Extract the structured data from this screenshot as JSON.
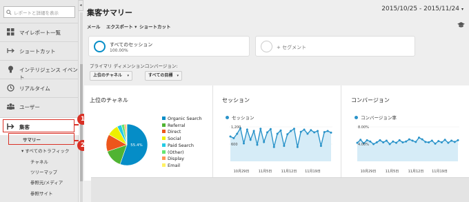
{
  "sidebar": {
    "search_placeholder": "レポートと詳細を表示",
    "collapse": "◂",
    "items": [
      {
        "label": "マイレポート一覧"
      },
      {
        "label": "ショートカット"
      },
      {
        "label": "インテリジェンス イベント"
      },
      {
        "label": "リアルタイム"
      },
      {
        "label": "ユーザー"
      },
      {
        "label": "集客"
      }
    ],
    "sub_items": {
      "summary": "サマリー",
      "all_traffic": "▾ すべてのトラフィック",
      "channels": "チャネル",
      "treemap": "ツリーマップ",
      "source_medium": "参照元/メディア",
      "referrals": "参照サイト"
    }
  },
  "annotations": {
    "badge1": "1",
    "badge2": "2"
  },
  "header": {
    "title": "集客サマリー",
    "date_range": "2015/10/25 - 2015/11/24",
    "date_caret": "▾"
  },
  "toolbar": {
    "email": "メール",
    "export": "エクスポート ▾",
    "shortcut": "ショートカット"
  },
  "segments": {
    "all_sessions": "すべてのセッション",
    "all_sessions_pct": "100.00%",
    "add_segment": "+ セグメント"
  },
  "dimensions": {
    "primary_label": "プライマリ ディメンション:",
    "conversion_label": "コンバージョン:",
    "primary_value": "上位のチャネル",
    "conversion_value": "すべての目標",
    "caret": "▾"
  },
  "panels": {
    "channels_title": "上位のチャネル",
    "sessions_title": "セッション",
    "conversions_title": "コンバージョン",
    "sessions_metric": "セッション",
    "conversions_metric": "コンバージョン率"
  },
  "pie": {
    "center_label": "55.4%",
    "slices": [
      {
        "name": "Organic Search",
        "value": 55.4,
        "color": "#058dc7"
      },
      {
        "name": "Referral",
        "value": 14.4,
        "color": "#50b432"
      },
      {
        "name": "Direct",
        "value": 13.4,
        "color": "#ed561b"
      },
      {
        "name": "Social",
        "value": 9.0,
        "color": "#edef00"
      },
      {
        "name": "Paid Search",
        "value": 3.5,
        "color": "#24cbe5"
      },
      {
        "name": "(Other)",
        "value": 2.3,
        "color": "#64e572"
      },
      {
        "name": "Display",
        "value": 1.2,
        "color": "#ff9655"
      },
      {
        "name": "Email",
        "value": 0.8,
        "color": "#fff263"
      }
    ]
  },
  "chart_data": [
    {
      "type": "area",
      "series": [
        {
          "name": "セッション",
          "values": [
            900,
            840,
            1000,
            1200,
            650,
            1150,
            780,
            1100,
            600,
            1180,
            700,
            1050,
            1170,
            520,
            1000,
            1120,
            560,
            980,
            1100,
            1180,
            520,
            1070,
            1150,
            1000,
            1130,
            1050,
            1100,
            560,
            1060,
            1100,
            1040
          ]
        }
      ],
      "y_ticks": [
        "1,200",
        "600"
      ],
      "x_ticks": [
        "10月29日",
        "11月5日",
        "11月12日",
        "11月19日"
      ],
      "color": "#2a93c9"
    },
    {
      "type": "area",
      "series": [
        {
          "name": "コンバージョン率",
          "values": [
            4.3,
            5.0,
            4.2,
            4.9,
            4.6,
            4.0,
            4.4,
            4.9,
            4.4,
            4.8,
            4.0,
            4.6,
            4.3,
            4.9,
            4.4,
            4.6,
            5.1,
            4.8,
            4.5,
            5.5,
            5.1,
            4.5,
            4.4,
            4.8,
            4.1,
            4.7,
            4.4,
            5.0,
            4.3,
            4.8,
            4.5,
            4.9
          ]
        }
      ],
      "y_ticks": [
        "8.00%",
        "4.00%"
      ],
      "x_ticks": [
        "10月29日",
        "11月5日",
        "11月12日",
        "11月19日"
      ],
      "color": "#2a93c9"
    }
  ]
}
